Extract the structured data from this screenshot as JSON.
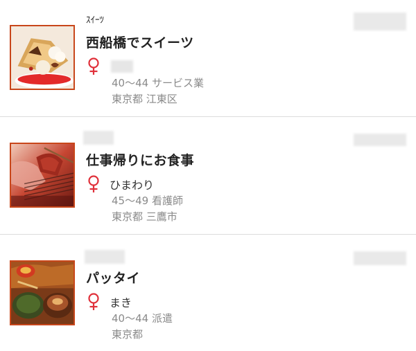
{
  "accent_color": "#e0303a",
  "thumb_border_color": "#c8461a",
  "items": [
    {
      "category": "ｽｲｰﾂ",
      "title": "西船橋でスイーツ",
      "gender_icon": "female-icon",
      "nickname": "",
      "age_job": "40〜44 サービス業",
      "location": "東京都 江東区",
      "thumbnail": "sweets-photo"
    },
    {
      "category": "",
      "title": "仕事帰りにお食事",
      "gender_icon": "female-icon",
      "nickname": "ひまわり",
      "age_job": "45〜49 看護師",
      "location": "東京都 三鷹市",
      "thumbnail": "grilled-meat-photo"
    },
    {
      "category": "",
      "title": "パッタイ",
      "gender_icon": "female-icon",
      "nickname": "まき",
      "age_job": "40〜44 派遣",
      "location": "東京都",
      "thumbnail": "thai-food-photo"
    }
  ]
}
